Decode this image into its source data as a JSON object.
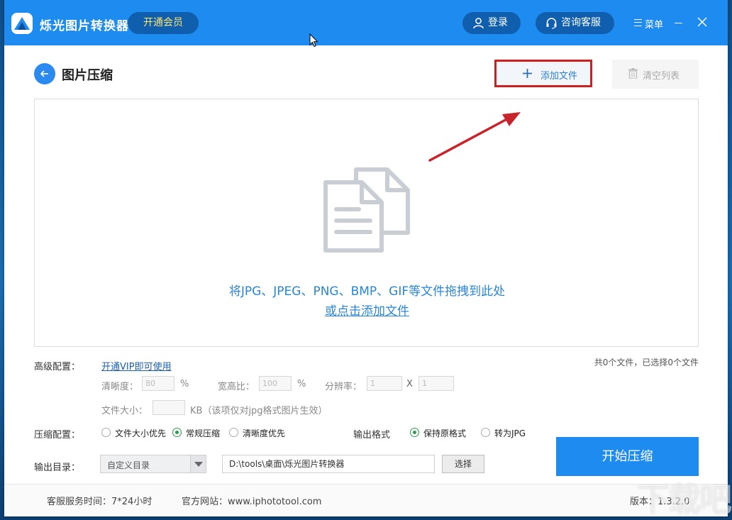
{
  "app": {
    "title": "烁光图片转换器",
    "vip_button": "开通会员",
    "login": "登录",
    "service": "咨询客服",
    "menu": "菜单"
  },
  "page": {
    "title": "图片压缩",
    "add_file": "添加文件",
    "clear_list": "清空列表"
  },
  "dropzone": {
    "hint": "将JPG、JPEG、PNG、BMP、GIF等文件拖拽到此处",
    "link": "或点击添加文件"
  },
  "file_count": "共0个文件，已选择0个文件",
  "advanced": {
    "label": "高级配置：",
    "vip_link": "开通VIP即可使用",
    "clarity_label": "清晰度：",
    "clarity_value": "80",
    "clarity_unit": "%",
    "aspect_label": "宽高比：",
    "aspect_value": "100",
    "aspect_unit": "%",
    "resolution_label": "分辨率：",
    "res_w": "1",
    "res_x": "X",
    "res_h": "1",
    "size_label": "文件大小：",
    "size_value": "",
    "size_unit": "KB（该项仅对jpg格式图片生效）"
  },
  "compression": {
    "label": "压缩配置：",
    "options": [
      "文件大小优先",
      "常规压缩",
      "清晰度优先"
    ],
    "selected_index": 1
  },
  "output_format": {
    "label": "输出格式",
    "options": [
      "保持原格式",
      "转为JPG"
    ],
    "selected_index": 0
  },
  "output_dir": {
    "label": "输出目录：",
    "mode": "自定义目录",
    "path": "D:\\tools\\桌面\\烁光图片转换器",
    "choose": "选择"
  },
  "start_button": "开始压缩",
  "footer": {
    "service_time": "客服服务时间：7*24小时",
    "website": "官方网站：www.iphototool.com",
    "version": "版本：1.3.2.0"
  },
  "watermark": "下载吧",
  "colors": {
    "primary": "#1e8bf0",
    "vip_text": "#ffe36b",
    "highlight_border": "#d01f1f",
    "radio_checked": "#2c9b4f"
  }
}
